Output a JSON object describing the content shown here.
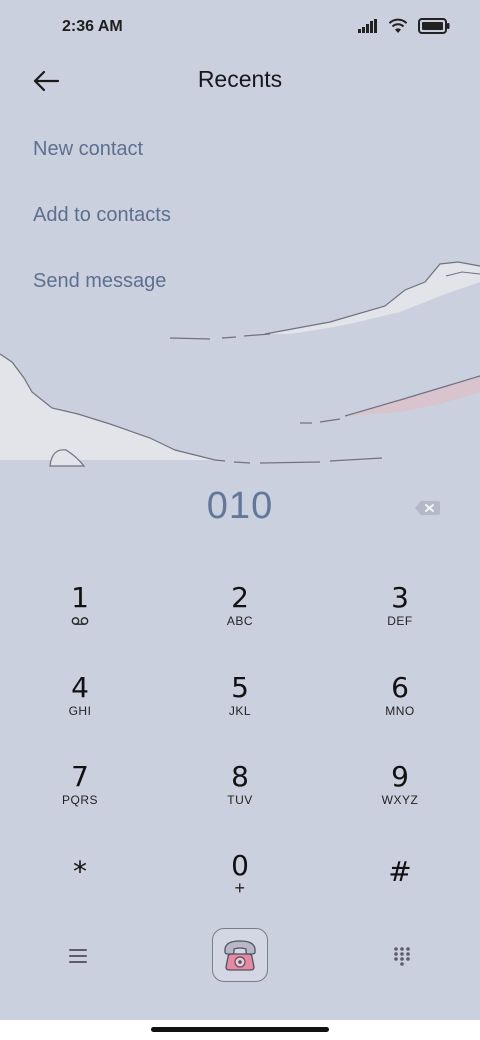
{
  "status_bar": {
    "time": "2:36 AM"
  },
  "header": {
    "title": "Recents"
  },
  "menu": [
    {
      "label": "New contact"
    },
    {
      "label": "Add to contacts"
    },
    {
      "label": "Send message"
    }
  ],
  "dialer": {
    "number": "010"
  },
  "keypad": [
    {
      "digit": "1",
      "letters": ""
    },
    {
      "digit": "2",
      "letters": "ABC"
    },
    {
      "digit": "3",
      "letters": "DEF"
    },
    {
      "digit": "4",
      "letters": "GHI"
    },
    {
      "digit": "5",
      "letters": "JKL"
    },
    {
      "digit": "6",
      "letters": "MNO"
    },
    {
      "digit": "7",
      "letters": "PQRS"
    },
    {
      "digit": "8",
      "letters": "TUV"
    },
    {
      "digit": "9",
      "letters": "WXYZ"
    },
    {
      "digit": "*",
      "letters": ""
    },
    {
      "digit": "0",
      "letters": "+"
    },
    {
      "digit": "#",
      "letters": ""
    }
  ],
  "icons": {
    "back": "arrow-left-icon",
    "backspace": "backspace-icon",
    "voicemail": "voicemail-icon",
    "menu": "menu-icon",
    "call": "phone-icon",
    "keypad_toggle": "dialpad-icon"
  },
  "colors": {
    "background": "#cbd0df",
    "accent_text": "#5d6f8f",
    "number_text": "#62779a",
    "call_phone_pink": "#e58aa0"
  }
}
